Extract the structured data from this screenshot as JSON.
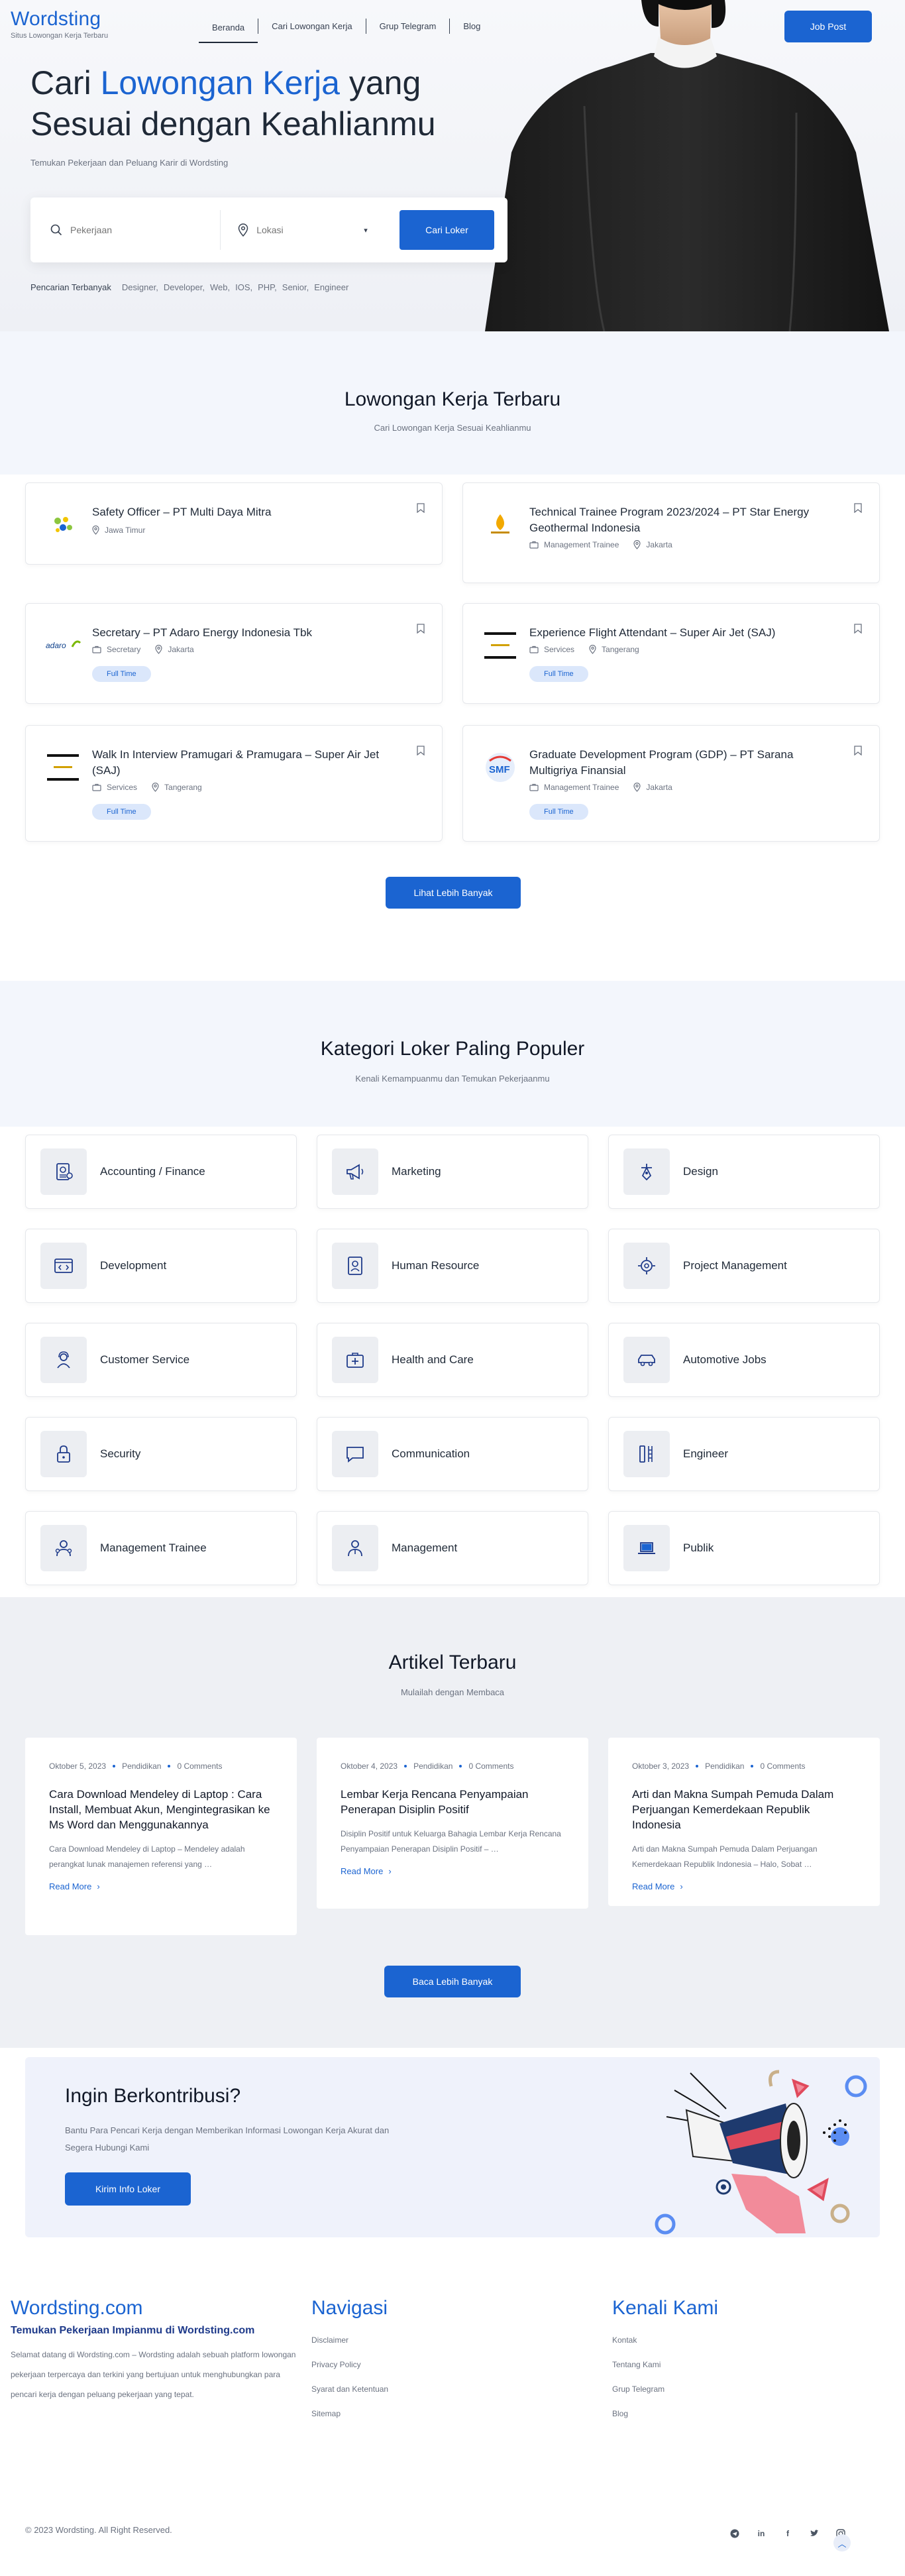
{
  "header": {
    "brand": "Wordsting",
    "tagline": "Situs Lowongan Kerja Terbaru",
    "nav": [
      "Beranda",
      "Cari Lowongan Kerja",
      "Grup Telegram",
      "Blog"
    ],
    "job_post_label": "Job Post"
  },
  "hero": {
    "title_pre": "Cari ",
    "title_accent": "Lowongan Kerja",
    "title_post": " yang",
    "title_line2": "Sesuai dengan Keahlianmu",
    "subtitle": "Temukan Pekerjaan dan Peluang Karir di Wordsting",
    "search": {
      "keyword_placeholder": "Pekerjaan",
      "location_placeholder": "Lokasi",
      "button_label": "Cari Loker"
    },
    "popular_label": "Pencarian Terbanyak",
    "popular_terms": [
      "Designer,",
      "Developer,",
      "Web,",
      "IOS,",
      "PHP,",
      "Senior,",
      "Engineer"
    ]
  },
  "jobs": {
    "title": "Lowongan Kerja Terbaru",
    "subtitle": "Cari Lowongan Kerja Sesuai Keahlianmu",
    "items": [
      {
        "title": "Safety Officer – PT Multi Daya Mitra",
        "category": "",
        "location": "Jawa Timur",
        "badge": ""
      },
      {
        "title": "Technical Trainee Program 2023/2024 – PT Star Energy Geothermal Indonesia",
        "category": "Management Trainee",
        "location": "Jakarta",
        "badge": ""
      },
      {
        "title": "Secretary – PT Adaro Energy Indonesia Tbk",
        "category": "Secretary",
        "location": "Jakarta",
        "badge": "Full Time"
      },
      {
        "title": "Experience Flight Attendant – Super Air Jet (SAJ)",
        "category": "Services",
        "location": "Tangerang",
        "badge": "Full Time"
      },
      {
        "title": "Walk In Interview Pramugari & Pramugara – Super Air Jet (SAJ)",
        "category": "Services",
        "location": "Tangerang",
        "badge": "Full Time"
      },
      {
        "title": "Graduate Development Program (GDP) – PT Sarana Multigriya Finansial",
        "category": "Management Trainee",
        "location": "Jakarta",
        "badge": "Full Time"
      }
    ],
    "logo_texts": [
      "adaro",
      "SMF"
    ],
    "more_label": "Lihat Lebih Banyak"
  },
  "categories": {
    "title": "Kategori Loker Paling Populer",
    "subtitle": "Kenali Kemampuanmu dan Temukan Pekerjaanmu",
    "items": [
      {
        "label": "Accounting / Finance",
        "icon": "finance-icon"
      },
      {
        "label": "Marketing",
        "icon": "megaphone-icon"
      },
      {
        "label": "Design",
        "icon": "pen-tool-icon"
      },
      {
        "label": "Development",
        "icon": "code-window-icon"
      },
      {
        "label": "Human Resource",
        "icon": "id-card-icon"
      },
      {
        "label": "Project Management",
        "icon": "project-gear-icon"
      },
      {
        "label": "Customer Service",
        "icon": "headset-icon"
      },
      {
        "label": "Health and Care",
        "icon": "medical-kit-icon"
      },
      {
        "label": "Automotive Jobs",
        "icon": "car-icon"
      },
      {
        "label": "Security",
        "icon": "lock-icon"
      },
      {
        "label": "Communication",
        "icon": "chat-icon"
      },
      {
        "label": "Engineer",
        "icon": "tools-icon"
      },
      {
        "label": "Management Trainee",
        "icon": "people-icon"
      },
      {
        "label": "Management",
        "icon": "manager-icon"
      },
      {
        "label": "Publik",
        "icon": "laptop-icon"
      }
    ]
  },
  "articles": {
    "title": "Artikel Terbaru",
    "subtitle": "Mulailah dengan Membaca",
    "items": [
      {
        "date": "Oktober 5, 2023",
        "category": "Pendidikan",
        "comments": "0 Comments",
        "title": "Cara Download Mendeley di Laptop : Cara Install, Membuat Akun, Mengintegrasikan ke Ms Word dan Menggunakannya",
        "excerpt": "Cara Download Mendeley di Laptop – Mendeley adalah perangkat lunak manajemen referensi yang …",
        "more": "Read More"
      },
      {
        "date": "Oktober 4, 2023",
        "category": "Pendidikan",
        "comments": "0 Comments",
        "title": "Lembar Kerja Rencana Penyampaian Penerapan Disiplin Positif",
        "excerpt": "Disiplin Positif untuk Keluarga Bahagia Lembar Kerja Rencana Penyampaian Penerapan Disiplin Positif – …",
        "more": "Read More"
      },
      {
        "date": "Oktober 3, 2023",
        "category": "Pendidikan",
        "comments": "0 Comments",
        "title": "Arti dan Makna Sumpah Pemuda Dalam Perjuangan Kemerdekaan Republik Indonesia",
        "excerpt": "Arti dan Makna Sumpah Pemuda Dalam Perjuangan Kemerdekaan Republik Indonesia – Halo, Sobat …",
        "more": "Read More"
      }
    ],
    "more_label": "Baca Lebih Banyak"
  },
  "contribute": {
    "title": "Ingin Berkontribusi?",
    "text": "Bantu Para Pencari Kerja dengan Memberikan Informasi Lowongan Kerja Akurat dan Segera Hubungi Kami",
    "button_label": "Kirim Info Loker"
  },
  "footer": {
    "brand": "Wordsting.com",
    "tagline": "Temukan Pekerjaan Impianmu di Wordsting.com",
    "description": "Selamat datang di Wordsting.com – Wordsting adalah sebuah platform lowongan pekerjaan terpercaya dan terkini yang bertujuan untuk menghubungkan para pencari kerja dengan peluang pekerjaan yang tepat.",
    "nav_title": "Navigasi",
    "nav_links": [
      "Disclaimer",
      "Privacy Policy",
      "Syarat dan Ketentuan",
      "Sitemap"
    ],
    "about_title": "Kenali Kami",
    "about_links": [
      "Kontak",
      "Tentang Kami",
      "Grup Telegram",
      "Blog"
    ],
    "copyright": "© 2023 Wordsting. All Right Reserved.",
    "socials": [
      "telegram-icon",
      "linkedin-icon",
      "facebook-icon",
      "twitter-icon",
      "instagram-icon"
    ]
  },
  "colors": {
    "accent": "#1b64d1",
    "hero_bg": "#eef0f5",
    "section_bg": "#f3f6fc",
    "badge_bg": "#dbe7fb"
  }
}
